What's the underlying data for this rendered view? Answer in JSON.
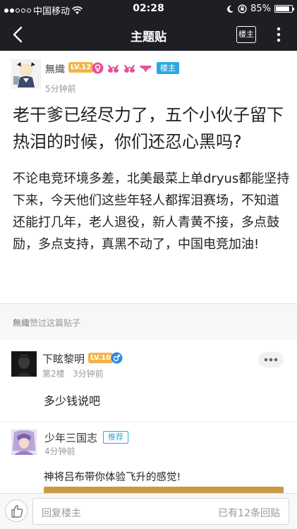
{
  "status_bar": {
    "carrier": "中国移动",
    "time": "02:28",
    "battery": "85%",
    "battery_level": 0.85
  },
  "navbar": {
    "title": "主题贴",
    "owner_button": "楼主"
  },
  "post": {
    "author": "無織",
    "level": "LV.12",
    "owner_badge": "楼主",
    "time": "5分钟前",
    "title": "老干爹已经尽力了，五个小伙子留下热泪的时候，你们还忍心黑吗?",
    "body": "不论电竞环境多差，北美最菜上单dryus都能坚持下来，今天他们这些年轻人都挥泪赛场，不知道还能打几年，老人退役，新人青黄不接，多点鼓励，多点支持，真黑不动了，中国电竞加油!"
  },
  "likes": {
    "user": "無織",
    "text": "赞过这篇贴子"
  },
  "replies": [
    {
      "author": "下眩黎明",
      "level": "LV.10",
      "floor": "第2楼",
      "time": "3分钟前",
      "text": "多少钱说吧"
    },
    {
      "author": "少年三国志",
      "tag": "推荐",
      "time": "4分钟前",
      "text": "神将吕布带你体验飞升的感觉!"
    }
  ],
  "bottom_bar": {
    "placeholder": "回复楼主",
    "reply_count": "已有12条回贴"
  },
  "colors": {
    "bar_bg": "#1d1f24",
    "accent_blue": "#2da7e0",
    "level_gold": "#f2b54a"
  }
}
